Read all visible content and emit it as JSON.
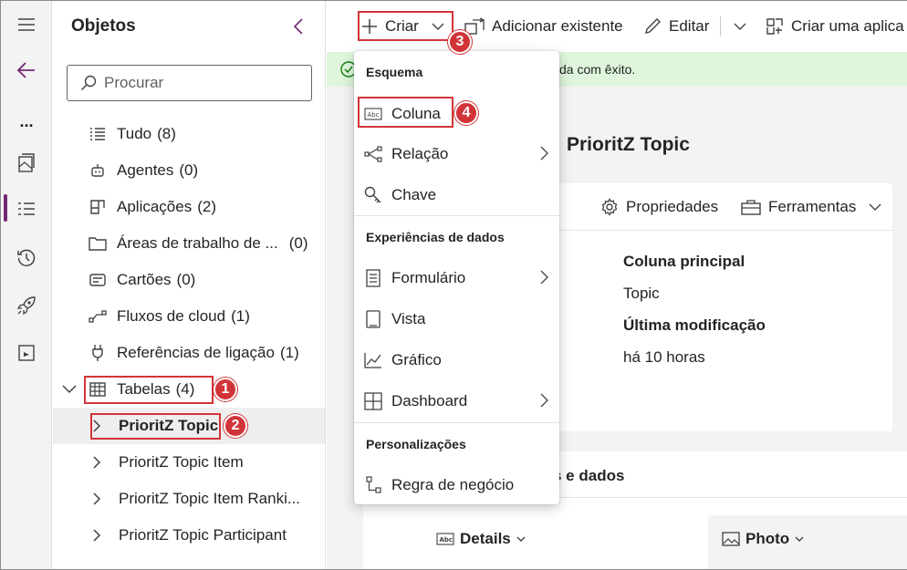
{
  "colors": {
    "brand": "#742774",
    "highlight_red": "#d13438",
    "success_bg": "#dff6dd",
    "success_icon": "#107c10"
  },
  "rail": {
    "items": [
      {
        "icon": "hamburger-icon"
      },
      {
        "icon": "back-arrow-icon"
      },
      {
        "icon": "more-icon",
        "label": "..."
      },
      {
        "icon": "pages-icon"
      },
      {
        "icon": "objects-list-icon"
      },
      {
        "icon": "history-icon"
      },
      {
        "icon": "rocket-icon"
      },
      {
        "icon": "power-bi-icon"
      }
    ]
  },
  "objects_panel": {
    "title": "Objetos",
    "search_placeholder": "Procurar",
    "items": [
      {
        "label": "Tudo",
        "count": "(8)",
        "icon": "list-icon"
      },
      {
        "label": "Agentes",
        "count": "(0)",
        "icon": "agent-icon"
      },
      {
        "label": "Aplicações",
        "count": "(2)",
        "icon": "apps-icon"
      },
      {
        "label": "Áreas de trabalho de ...",
        "count": "(0)",
        "icon": "folder-icon"
      },
      {
        "label": "Cartões",
        "count": "(0)",
        "icon": "card-icon"
      },
      {
        "label": "Fluxos de cloud",
        "count": "(1)",
        "icon": "flow-icon"
      },
      {
        "label": "Referências de ligação",
        "count": "(1)",
        "icon": "plug-icon"
      },
      {
        "label": "Tabelas",
        "count": "(4)",
        "icon": "table-icon"
      }
    ],
    "tables": [
      {
        "label": "PrioritZ Topic",
        "selected": true
      },
      {
        "label": "PrioritZ Topic Item"
      },
      {
        "label": "PrioritZ Topic Item Ranki..."
      },
      {
        "label": "PrioritZ Topic Participant"
      }
    ]
  },
  "badges": {
    "b1": "1",
    "b2": "2",
    "b3": "3",
    "b4": "4"
  },
  "command_bar": {
    "create": "Criar",
    "add_existing": "Adicionar existente",
    "edit": "Editar",
    "create_app": "Criar uma aplica"
  },
  "banner": {
    "text_fragment": "da com êxito."
  },
  "table_detail": {
    "title": "PrioritZ Topic",
    "properties": "Propriedades",
    "tools": "Ferramentas",
    "primary_column_label": "Coluna principal",
    "primary_column_value": "Topic",
    "last_modified_label": "Última modificação",
    "last_modified_value": "há 10 horas",
    "section_fragment": "s e dados",
    "columns": [
      {
        "label": "Details",
        "icon": "abc-icon"
      },
      {
        "label": "Photo",
        "icon": "image-icon"
      }
    ]
  },
  "create_menu": {
    "sections": [
      {
        "header": "Esquema",
        "items": [
          {
            "label": "Coluna",
            "icon": "abc-icon"
          },
          {
            "label": "Relação",
            "icon": "relationship-icon",
            "submenu": true
          },
          {
            "label": "Chave",
            "icon": "key-icon"
          }
        ]
      },
      {
        "header": "Experiências de dados",
        "items": [
          {
            "label": "Formulário",
            "icon": "form-icon",
            "submenu": true
          },
          {
            "label": "Vista",
            "icon": "view-icon"
          },
          {
            "label": "Gráfico",
            "icon": "chart-icon"
          },
          {
            "label": "Dashboard",
            "icon": "dashboard-icon",
            "submenu": true
          }
        ]
      },
      {
        "header": "Personalizações",
        "items": [
          {
            "label": "Regra de negócio",
            "icon": "business-rule-icon"
          }
        ]
      }
    ]
  }
}
